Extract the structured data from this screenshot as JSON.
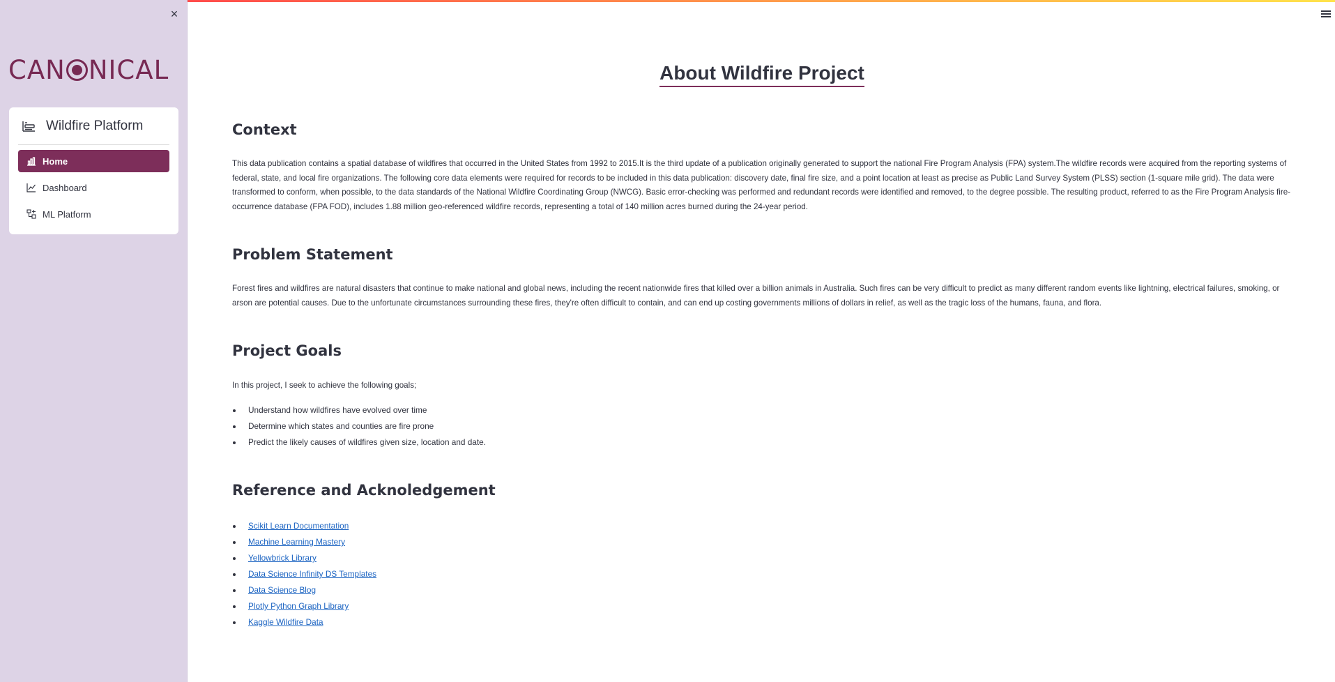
{
  "sidebar": {
    "close_glyph": "×",
    "logo_text_before": "CAN",
    "logo_text_after": "NICAL",
    "brand_color": "#772953",
    "menu_title": "Wildfire Platform",
    "items": [
      {
        "label": "Home",
        "icon": "bar-chart-icon",
        "active": true
      },
      {
        "label": "Dashboard",
        "icon": "line-chart-icon",
        "active": false
      },
      {
        "label": "ML Platform",
        "icon": "network-icon",
        "active": false
      }
    ]
  },
  "main": {
    "title": "About Wildfire Project",
    "context_heading": "Context",
    "context_text": "This data publication contains a spatial database of wildfires that occurred in the United States from 1992 to 2015.It is the third update of a publication originally generated to support the national Fire Program Analysis (FPA) system.The wildfire records were acquired from the reporting systems of federal, state, and local fire organizations. The following core data elements were required for records to be included in this data publication: discovery date, final fire size, and a point location at least as precise as Public Land Survey System (PLSS) section (1-square mile grid). The data were transformed to conform, when possible, to the data standards of the National Wildfire Coordinating Group (NWCG). Basic error-checking was performed and redundant records were identified and removed, to the degree possible. The resulting product, referred to as the Fire Program Analysis fire-occurrence database (FPA FOD), includes 1.88 million geo-referenced wildfire records, representing a total of 140 million acres burned during the 24-year period.",
    "problem_heading": "Problem Statement",
    "problem_text": "Forest fires and wildfires are natural disasters that continue to make national and global news, including the recent nationwide fires that killed over a billion animals in Australia. Such fires can be very difficult to predict as many different random events like lightning, electrical failures, smoking, or arson are potential causes. Due to the unfortunate circumstances surrounding these fires, they're often difficult to contain, and can end up costing governments millions of dollars in relief, as well as the tragic loss of the humans, fauna, and flora.",
    "goals_heading": "Project Goals",
    "goals_intro": "In this project, I seek to achieve the following goals;",
    "goals": [
      "Understand how wildfires have evolved over time",
      "Determine which states and counties are fire prone",
      "Predict the likely causes of wildfires given size, location and date."
    ],
    "references_heading": "Reference and Acknoledgement",
    "references": [
      "Scikit Learn Documentation",
      "Machine Learning Mastery",
      "Yellowbrick Library",
      "Data Science Infinity DS Templates",
      "Data Science Blog",
      "Plotly Python Graph Library",
      "Kaggle Wildfire Data"
    ]
  }
}
